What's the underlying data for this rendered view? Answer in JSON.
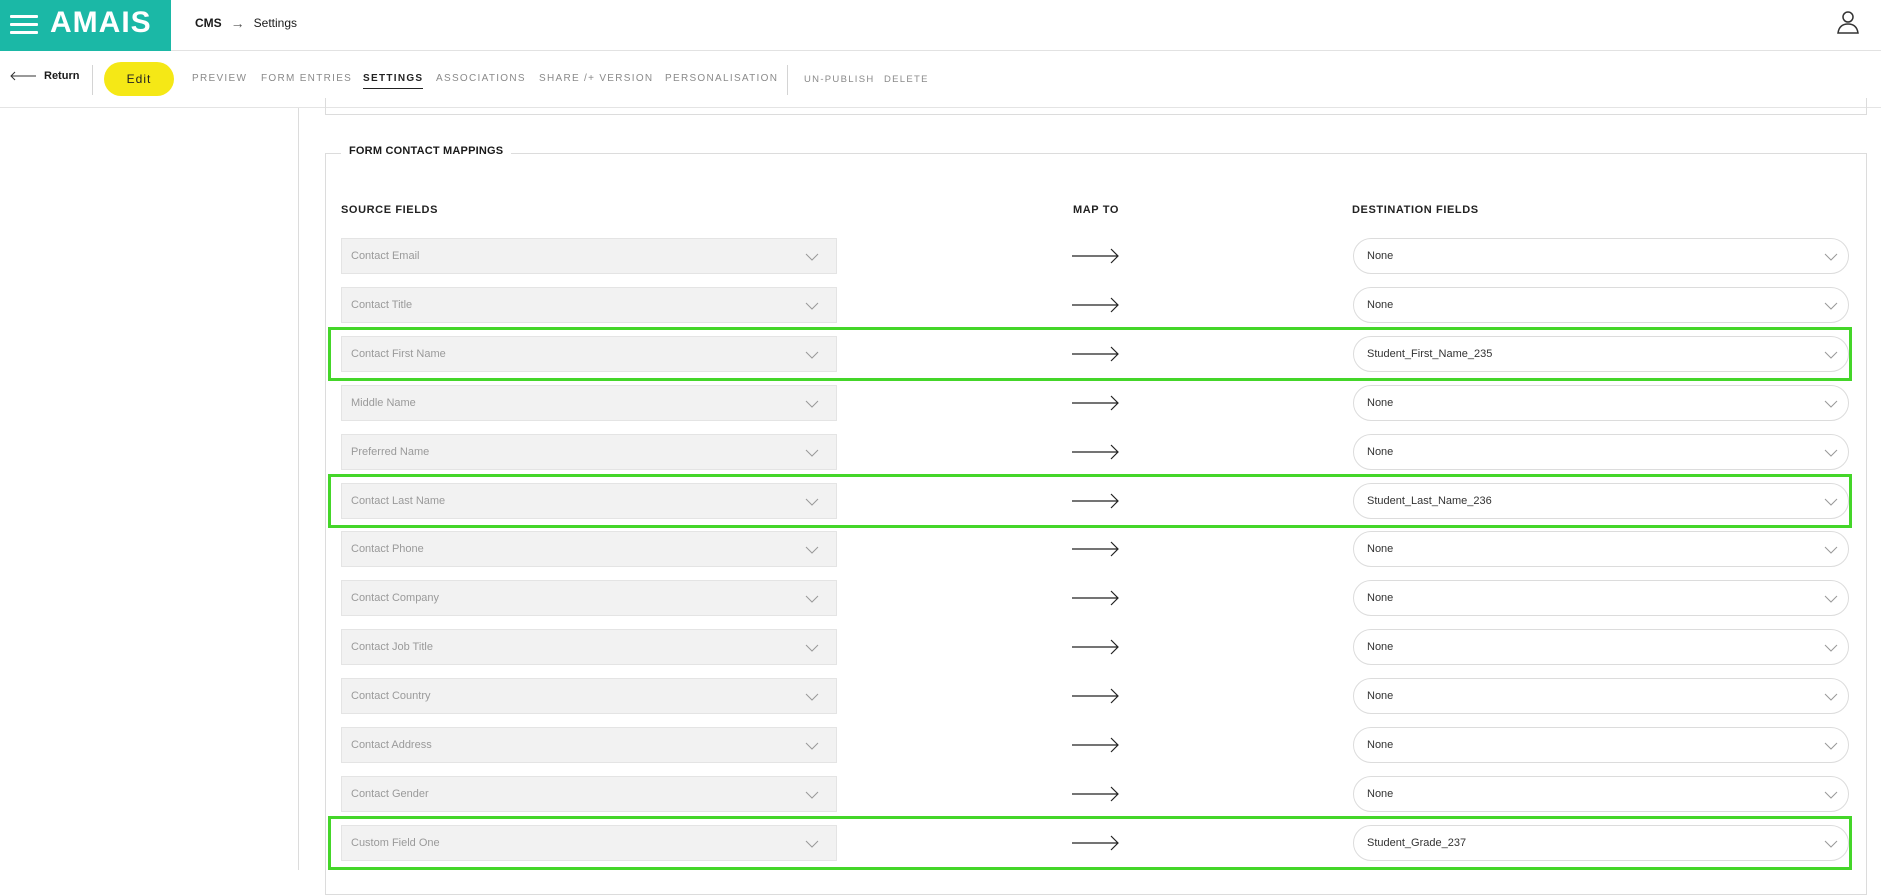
{
  "header": {
    "logo": "AMAIS",
    "breadcrumb": {
      "root": "CMS",
      "current": "Settings"
    }
  },
  "toolbar": {
    "return_label": "Return",
    "edit_label": "Edit",
    "tabs": [
      {
        "label": "PREVIEW",
        "active": false
      },
      {
        "label": "FORM ENTRIES",
        "active": false
      },
      {
        "label": "SETTINGS",
        "active": true
      },
      {
        "label": "ASSOCIATIONS",
        "active": false
      },
      {
        "label": "SHARE /+ VERSION",
        "active": false
      },
      {
        "label": "PERSONALISATION",
        "active": false
      }
    ],
    "actions": [
      {
        "label": "UN-PUBLISH"
      },
      {
        "label": "DELETE"
      }
    ]
  },
  "mappings": {
    "legend": "FORM CONTACT MAPPINGS",
    "headers": {
      "source": "SOURCE FIELDS",
      "map": "MAP TO",
      "destination": "DESTINATION FIELDS"
    },
    "rows": [
      {
        "source": "Contact Email",
        "destination": "None",
        "highlighted": false
      },
      {
        "source": "Contact Title",
        "destination": "None",
        "highlighted": false
      },
      {
        "source": "Contact First Name",
        "destination": "Student_First_Name_235",
        "highlighted": true
      },
      {
        "source": "Middle Name",
        "destination": "None",
        "highlighted": false
      },
      {
        "source": "Preferred Name",
        "destination": "None",
        "highlighted": false
      },
      {
        "source": "Contact Last Name",
        "destination": "Student_Last_Name_236",
        "highlighted": true
      },
      {
        "source": "Contact Phone",
        "destination": "None",
        "highlighted": false
      },
      {
        "source": "Contact Company",
        "destination": "None",
        "highlighted": false
      },
      {
        "source": "Contact Job Title",
        "destination": "None",
        "highlighted": false
      },
      {
        "source": "Contact Country",
        "destination": "None",
        "highlighted": false
      },
      {
        "source": "Contact Address",
        "destination": "None",
        "highlighted": false
      },
      {
        "source": "Contact Gender",
        "destination": "None",
        "highlighted": false
      },
      {
        "source": "Custom Field One",
        "destination": "Student_Grade_237",
        "highlighted": true
      }
    ]
  },
  "colors": {
    "brand": "#1bb8a6",
    "edit_button": "#f5e816",
    "highlight": "#44d629"
  }
}
